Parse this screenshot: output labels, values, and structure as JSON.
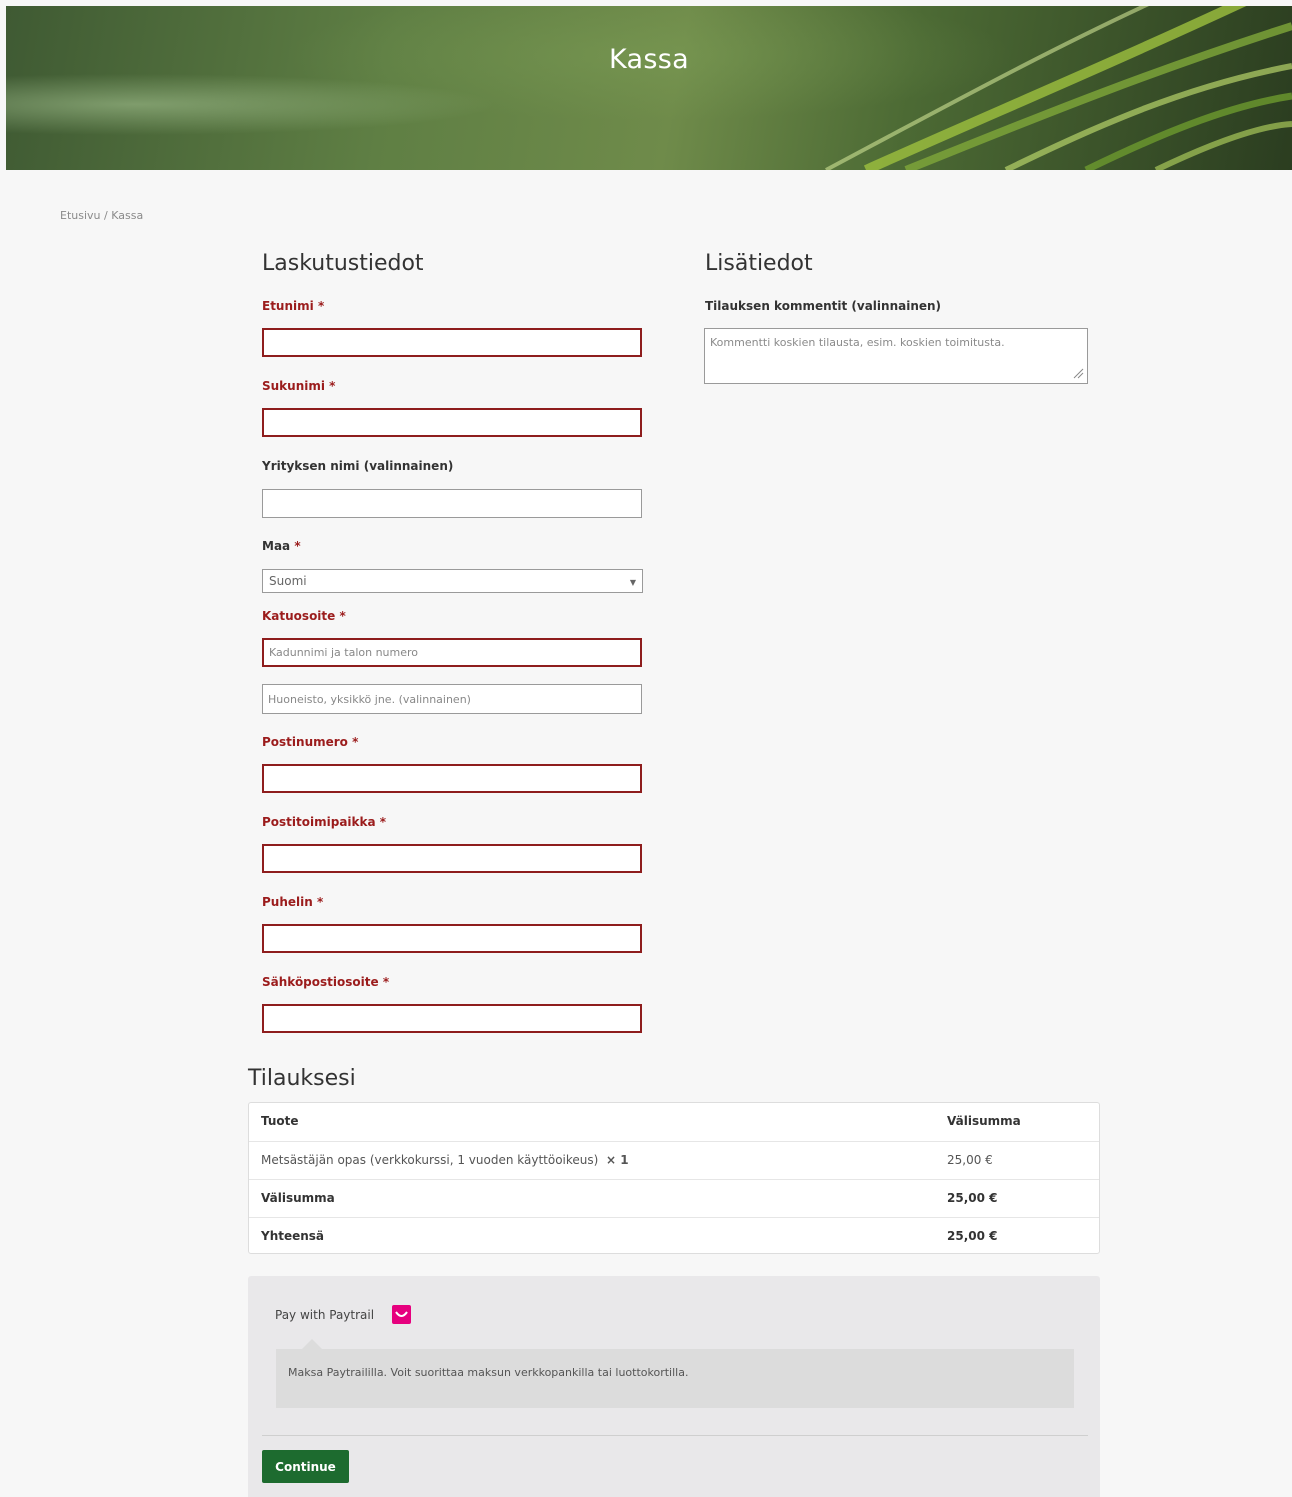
{
  "page": {
    "title": "Kassa"
  },
  "breadcrumb": {
    "home": "Etusivu",
    "separator": " / ",
    "current": "Kassa"
  },
  "billing": {
    "heading": "Laskutustiedot",
    "first_name_label": "Etunimi",
    "last_name_label": "Sukunimi",
    "company_label": "Yrityksen nimi (valinnainen)",
    "country_label": "Maa",
    "country_value": "Suomi",
    "street_label": "Katuosoite",
    "street_placeholder": "Kadunnimi ja talon numero",
    "street2_placeholder": "Huoneisto, yksikkö jne. (valinnainen)",
    "postcode_label": "Postinumero",
    "city_label": "Postitoimipaikka",
    "phone_label": "Puhelin",
    "email_label": "Sähköpostiosoite",
    "required_mark": "*"
  },
  "additional": {
    "heading": "Lisätiedot",
    "comments_label": "Tilauksen kommentit (valinnainen)",
    "comments_placeholder": "Kommentti koskien tilausta, esim. koskien toimitusta."
  },
  "order": {
    "heading": "Tilauksesi",
    "col_product": "Tuote",
    "col_subtotal": "Välisumma",
    "item_name": "Metsästäjän opas (verkkokurssi, 1 vuoden käyttöoikeus)",
    "item_qty": "× 1",
    "item_price": "25,00 €",
    "subtotal_label": "Välisumma",
    "subtotal_value": "25,00 €",
    "total_label": "Yhteensä",
    "total_value": "25,00 €"
  },
  "payment": {
    "method_label": "Pay with Paytrail",
    "description": "Maksa Paytraililla. Voit suorittaa maksun verkkopankilla tai luottokortilla.",
    "continue_label": "Continue",
    "brand_color": "#e6007e",
    "button_color": "#1d6b2f"
  },
  "colors": {
    "error": "#8e1d1d",
    "background": "#f7f7f7"
  }
}
